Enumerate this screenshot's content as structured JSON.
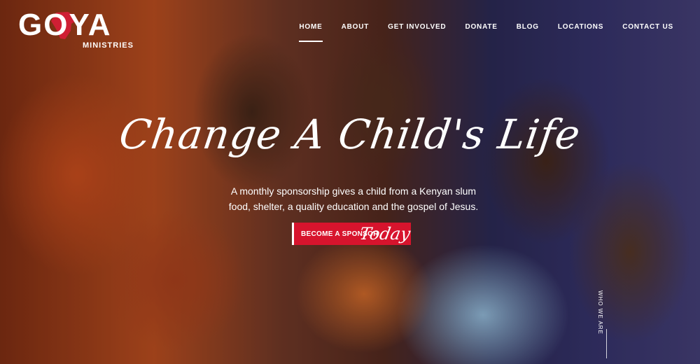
{
  "brand": {
    "name": "GOYA",
    "sub": "MINISTRIES",
    "map_icon": "africa-map-icon"
  },
  "nav": {
    "items": [
      {
        "label": "HOME",
        "active": true
      },
      {
        "label": "ABOUT",
        "active": false
      },
      {
        "label": "GET INVOLVED",
        "active": false
      },
      {
        "label": "DONATE",
        "active": false
      },
      {
        "label": "BLOG",
        "active": false
      },
      {
        "label": "LOCATIONS",
        "active": false
      },
      {
        "label": "CONTACT US",
        "active": false
      }
    ]
  },
  "hero": {
    "headline": "Change A Child's Life",
    "subtitle": "A monthly sponsorship gives a child from a Kenyan slum food, shelter, a quality education and the gospel of Jesus.",
    "cta_label": "BECOME A SPONSOR",
    "cta_script": "Today"
  },
  "scroll": {
    "label": "WHO WE ARE"
  },
  "colors": {
    "accent": "#d7142d"
  }
}
